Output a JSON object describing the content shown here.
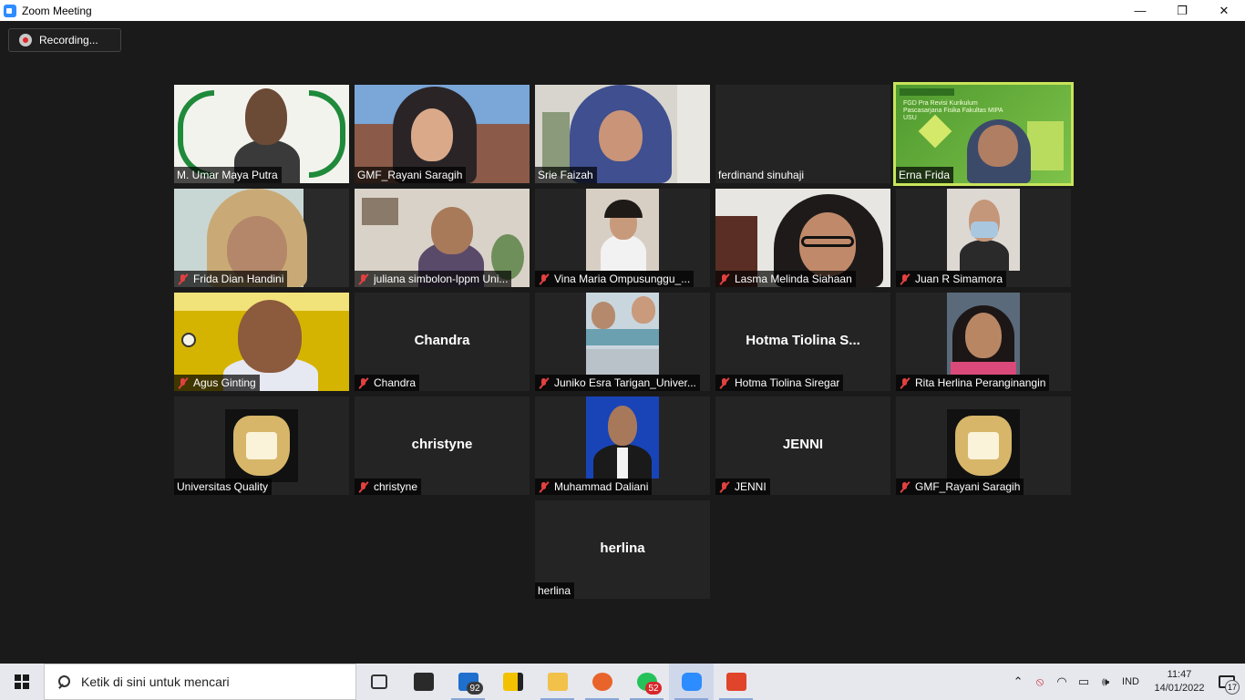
{
  "window": {
    "title": "Zoom Meeting",
    "minimize": "—",
    "restore": "❐",
    "close": "✕"
  },
  "recording": {
    "label": "Recording..."
  },
  "tiles": [
    {
      "name": "M. Umar Maya Putra",
      "muted": false
    },
    {
      "name": "GMF_Rayani Saragih",
      "muted": false
    },
    {
      "name": "Srie Faizah",
      "muted": false
    },
    {
      "name": "ferdinand sinuhaji",
      "muted": false
    },
    {
      "name": "Erna Frida",
      "muted": false,
      "active": true,
      "slide_title": "FGD Pra Revisi Kurikulum Pascasarjana Fisika Fakultas MIPA USU"
    },
    {
      "name": "Frida Dian Handini",
      "muted": true
    },
    {
      "name": "juliana simbolon-lppm Uni...",
      "muted": true
    },
    {
      "name": "Vina Maria Ompusunggu_...",
      "muted": true
    },
    {
      "name": "Lasma Melinda Siahaan",
      "muted": true
    },
    {
      "name": "Juan R Simamora",
      "muted": true
    },
    {
      "name": "Agus Ginting",
      "muted": true
    },
    {
      "name": "Chandra",
      "muted": true,
      "center": "Chandra"
    },
    {
      "name": "Juniko Esra Tarigan_Univer...",
      "muted": true
    },
    {
      "name": "Hotma Tiolina Siregar",
      "muted": true,
      "center": "Hotma Tiolina S..."
    },
    {
      "name": "Rita Herlina Peranginangin",
      "muted": true
    },
    {
      "name": "Universitas Quality",
      "muted": false
    },
    {
      "name": "christyne",
      "muted": true,
      "center": "christyne"
    },
    {
      "name": "Muhammad Daliani",
      "muted": true
    },
    {
      "name": "JENNI",
      "muted": true,
      "center": "JENNI"
    },
    {
      "name": "GMF_Rayani Saragih",
      "muted": true
    },
    {
      "name": "herlina",
      "muted": false,
      "center": "herlina"
    }
  ],
  "taskbar": {
    "search_placeholder": "Ketik di sini untuk mencari",
    "mail_badge": "92",
    "whatsapp_badge": "52",
    "language": "IND",
    "time": "11:47",
    "date": "14/01/2022",
    "notification_count": "17"
  },
  "colors": {
    "active_speaker_border": "#c9e45b",
    "muted_mic": "#e24040",
    "tile_bg": "#242424",
    "stage_bg": "#1a1a1a"
  }
}
